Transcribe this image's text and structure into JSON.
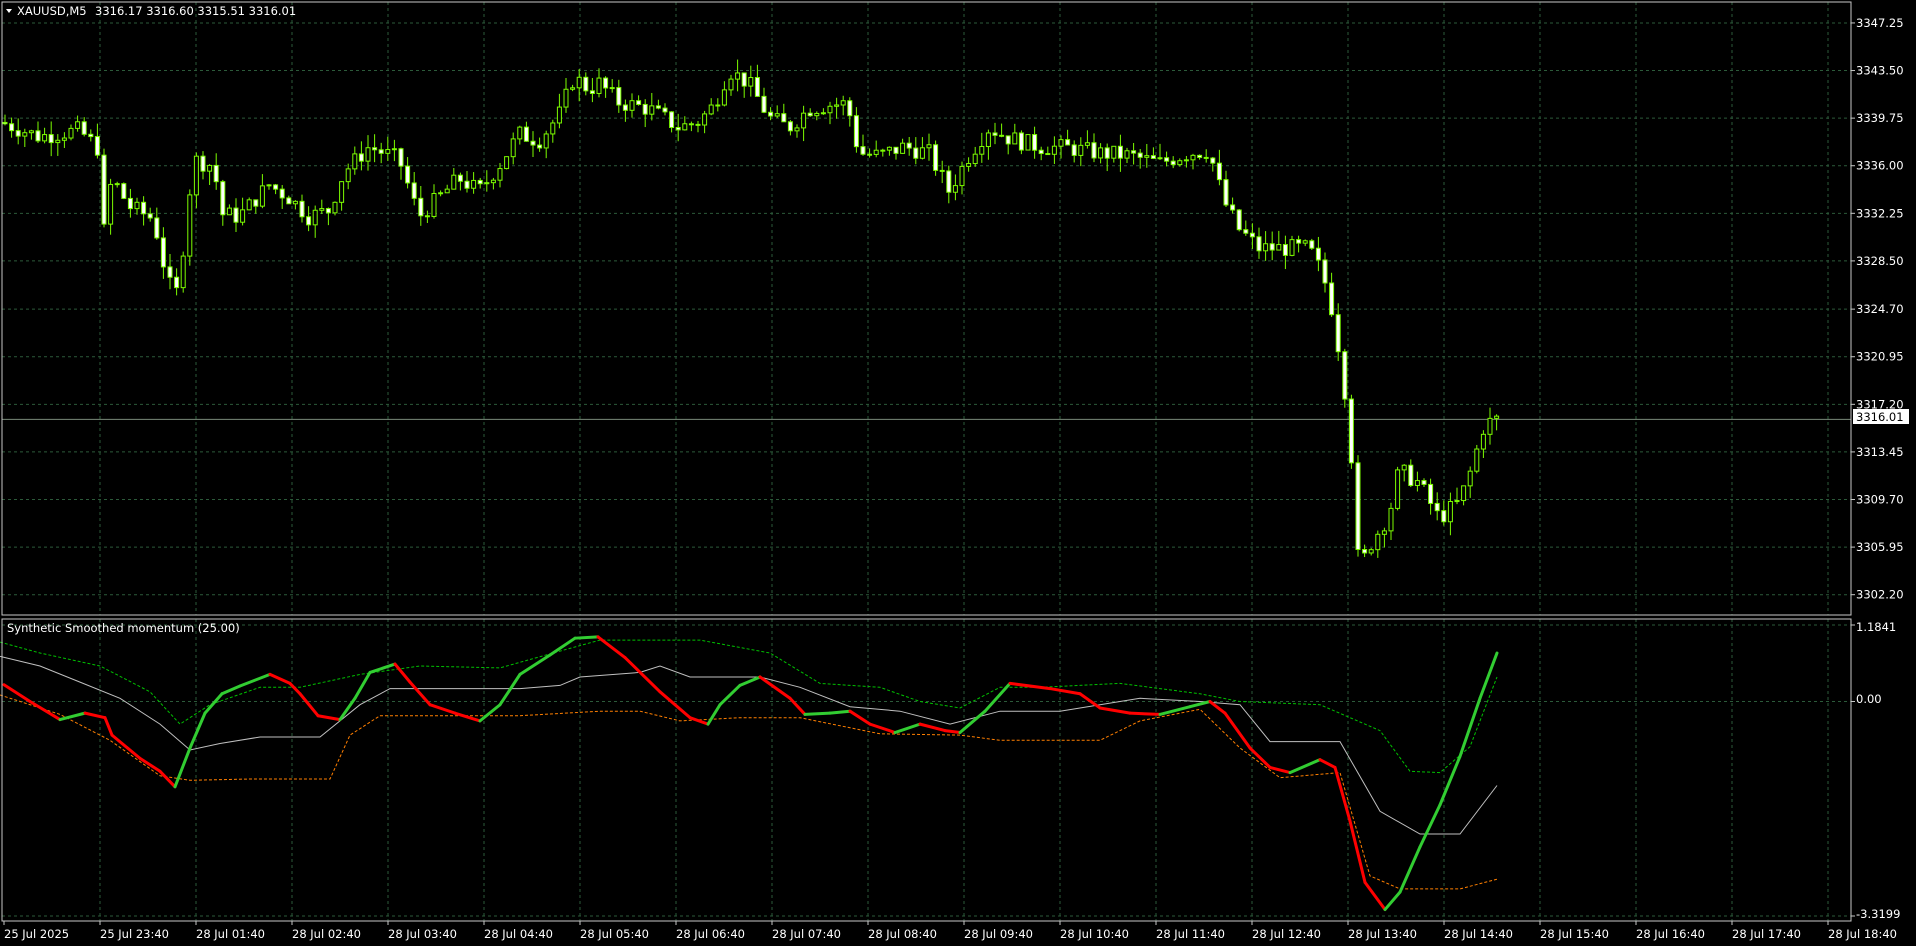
{
  "header": {
    "symbol_label": "XAUUSD,M5",
    "ohlc": "3316.17 3316.60 3315.51 3316.01",
    "arrow_icon": "triangle-down-icon"
  },
  "indicator": {
    "title": "Synthetic Smoothed momentum (25.00)",
    "y_top_label": "1.1841",
    "y_zero_label": "0.00",
    "y_bottom_label": "-3.3199"
  },
  "price_axis": {
    "labels": [
      "3347.25",
      "3343.50",
      "3339.75",
      "3336.00",
      "3332.25",
      "3328.50",
      "3324.70",
      "3320.95",
      "3317.20",
      "3313.45",
      "3309.70",
      "3305.95",
      "3302.20"
    ],
    "current_price": "3316.01"
  },
  "time_axis": {
    "labels": [
      "25 Jul 2025",
      "25 Jul 23:40",
      "28 Jul 01:40",
      "28 Jul 02:40",
      "28 Jul 03:40",
      "28 Jul 04:40",
      "28 Jul 05:40",
      "28 Jul 06:40",
      "28 Jul 07:40",
      "28 Jul 08:40",
      "28 Jul 09:40",
      "28 Jul 10:40",
      "28 Jul 11:40",
      "28 Jul 12:40",
      "28 Jul 13:40",
      "28 Jul 14:40",
      "28 Jul 15:40",
      "28 Jul 16:40",
      "28 Jul 17:40",
      "28 Jul 18:40"
    ]
  },
  "colors": {
    "background": "#000000",
    "grid": "#2c5a3a",
    "candle": "#7cfc00",
    "momentum_up": "#32cd32",
    "momentum_down": "#ff0000",
    "band_upper": "#00c000",
    "band_lower": "#ff7f00",
    "signal": "#c0c0c0"
  },
  "chart_data": [
    {
      "type": "candlestick",
      "title": "XAUUSD,M5",
      "ylim": [
        3300.6,
        3348.9
      ],
      "close_path": [
        [
          0,
          3339.5
        ],
        [
          40,
          3338.3
        ],
        [
          80,
          3338.8
        ],
        [
          100,
          3337.3
        ],
        [
          108,
          3327.0
        ],
        [
          112,
          3335.2
        ],
        [
          130,
          3332.8
        ],
        [
          155,
          3331.8
        ],
        [
          162,
          3329.0
        ],
        [
          176,
          3325.2
        ],
        [
          186,
          3330.5
        ],
        [
          194,
          3336.5
        ],
        [
          215,
          3336.0
        ],
        [
          222,
          3332.2
        ],
        [
          240,
          3332.0
        ],
        [
          270,
          3334.5
        ],
        [
          290,
          3333.5
        ],
        [
          310,
          3332.0
        ],
        [
          330,
          3332.5
        ],
        [
          345,
          3335.5
        ],
        [
          370,
          3337.5
        ],
        [
          400,
          3336.5
        ],
        [
          420,
          3332.0
        ],
        [
          440,
          3333.5
        ],
        [
          460,
          3335.0
        ],
        [
          480,
          3334.0
        ],
        [
          500,
          3336.0
        ],
        [
          520,
          3338.5
        ],
        [
          540,
          3338.0
        ],
        [
          560,
          3340.0
        ],
        [
          575,
          3343.0
        ],
        [
          590,
          3342.0
        ],
        [
          600,
          3342.5
        ],
        [
          620,
          3341.0
        ],
        [
          650,
          3340.5
        ],
        [
          680,
          3339.0
        ],
        [
          700,
          3339.5
        ],
        [
          715,
          3340.8
        ],
        [
          730,
          3343.5
        ],
        [
          750,
          3342.5
        ],
        [
          770,
          3339.8
        ],
        [
          790,
          3339.0
        ],
        [
          810,
          3340.5
        ],
        [
          830,
          3340.8
        ],
        [
          848,
          3340.9
        ],
        [
          860,
          3337.0
        ],
        [
          880,
          3336.8
        ],
        [
          905,
          3337.5
        ],
        [
          930,
          3337.0
        ],
        [
          950,
          3334.0
        ],
        [
          970,
          3336.8
        ],
        [
          990,
          3339.0
        ],
        [
          1010,
          3338.2
        ],
        [
          1040,
          3337.5
        ],
        [
          1070,
          3337.4
        ],
        [
          1100,
          3337.0
        ],
        [
          1130,
          3336.8
        ],
        [
          1160,
          3336.2
        ],
        [
          1190,
          3337.0
        ],
        [
          1210,
          3337.2
        ],
        [
          1225,
          3333.2
        ],
        [
          1240,
          3331.0
        ],
        [
          1260,
          3329.5
        ],
        [
          1280,
          3329.5
        ],
        [
          1310,
          3329.5
        ],
        [
          1320,
          3328.0
        ],
        [
          1330,
          3326.0
        ],
        [
          1340,
          3321.5
        ],
        [
          1350,
          3316.0
        ],
        [
          1360,
          3304.0
        ],
        [
          1370,
          3306.0
        ],
        [
          1390,
          3308.5
        ],
        [
          1400,
          3312.0
        ],
        [
          1420,
          3311.0
        ],
        [
          1440,
          3308.2
        ],
        [
          1460,
          3309.5
        ],
        [
          1470,
          3311.5
        ],
        [
          1485,
          3315.5
        ],
        [
          1495,
          3316.0
        ]
      ]
    },
    {
      "type": "line",
      "title": "Synthetic Smoothed momentum (25.00)",
      "ylim": [
        -3.3199,
        1.1841
      ],
      "momentum": [
        [
          4,
          0.26
        ],
        [
          30,
          0.0
        ],
        [
          60,
          -0.28
        ],
        [
          85,
          -0.18
        ],
        [
          105,
          -0.25
        ],
        [
          112,
          -0.52
        ],
        [
          140,
          -0.88
        ],
        [
          160,
          -1.08
        ],
        [
          175,
          -1.32
        ],
        [
          190,
          -0.72
        ],
        [
          205,
          -0.18
        ],
        [
          222,
          0.12
        ],
        [
          240,
          0.24
        ],
        [
          270,
          0.42
        ],
        [
          290,
          0.28
        ],
        [
          300,
          0.12
        ],
        [
          318,
          -0.22
        ],
        [
          340,
          -0.28
        ],
        [
          355,
          0.05
        ],
        [
          370,
          0.45
        ],
        [
          395,
          0.58
        ],
        [
          410,
          0.3
        ],
        [
          430,
          -0.05
        ],
        [
          455,
          -0.18
        ],
        [
          480,
          -0.3
        ],
        [
          500,
          -0.05
        ],
        [
          520,
          0.42
        ],
        [
          550,
          0.72
        ],
        [
          575,
          0.98
        ],
        [
          598,
          1.0
        ],
        [
          625,
          0.68
        ],
        [
          660,
          0.15
        ],
        [
          690,
          -0.25
        ],
        [
          708,
          -0.35
        ],
        [
          720,
          -0.05
        ],
        [
          740,
          0.25
        ],
        [
          760,
          0.38
        ],
        [
          790,
          0.05
        ],
        [
          805,
          -0.2
        ],
        [
          830,
          -0.18
        ],
        [
          850,
          -0.15
        ],
        [
          870,
          -0.35
        ],
        [
          895,
          -0.48
        ],
        [
          920,
          -0.35
        ],
        [
          945,
          -0.45
        ],
        [
          960,
          -0.48
        ],
        [
          985,
          -0.15
        ],
        [
          1010,
          0.28
        ],
        [
          1050,
          0.2
        ],
        [
          1080,
          0.12
        ],
        [
          1100,
          -0.1
        ],
        [
          1130,
          -0.18
        ],
        [
          1160,
          -0.2
        ],
        [
          1190,
          -0.08
        ],
        [
          1210,
          0.0
        ],
        [
          1225,
          -0.18
        ],
        [
          1250,
          -0.72
        ],
        [
          1270,
          -1.02
        ],
        [
          1290,
          -1.1
        ],
        [
          1320,
          -0.9
        ],
        [
          1335,
          -1.02
        ],
        [
          1350,
          -1.85
        ],
        [
          1365,
          -2.8
        ],
        [
          1385,
          -3.22
        ],
        [
          1400,
          -2.95
        ],
        [
          1420,
          -2.25
        ],
        [
          1440,
          -1.6
        ],
        [
          1460,
          -0.85
        ],
        [
          1480,
          0.05
        ],
        [
          1497,
          0.75
        ]
      ],
      "band_upper": [
        [
          0,
          0.92
        ],
        [
          40,
          0.75
        ],
        [
          100,
          0.55
        ],
        [
          150,
          0.15
        ],
        [
          180,
          -0.35
        ],
        [
          210,
          -0.05
        ],
        [
          260,
          0.22
        ],
        [
          300,
          0.22
        ],
        [
          360,
          0.42
        ],
        [
          420,
          0.55
        ],
        [
          500,
          0.52
        ],
        [
          560,
          0.78
        ],
        [
          600,
          0.95
        ],
        [
          700,
          0.95
        ],
        [
          770,
          0.75
        ],
        [
          820,
          0.28
        ],
        [
          880,
          0.22
        ],
        [
          920,
          0.0
        ],
        [
          960,
          -0.1
        ],
        [
          1000,
          0.22
        ],
        [
          1040,
          0.22
        ],
        [
          1120,
          0.28
        ],
        [
          1200,
          0.12
        ],
        [
          1240,
          0.0
        ],
        [
          1320,
          -0.05
        ],
        [
          1380,
          -0.45
        ],
        [
          1410,
          -1.08
        ],
        [
          1440,
          -1.1
        ],
        [
          1470,
          -0.7
        ],
        [
          1497,
          0.38
        ]
      ],
      "band_lower": [
        [
          0,
          0.1
        ],
        [
          60,
          -0.2
        ],
        [
          110,
          -0.6
        ],
        [
          160,
          -1.15
        ],
        [
          190,
          -1.22
        ],
        [
          250,
          -1.2
        ],
        [
          330,
          -1.2
        ],
        [
          350,
          -0.52
        ],
        [
          380,
          -0.22
        ],
        [
          460,
          -0.22
        ],
        [
          520,
          -0.22
        ],
        [
          600,
          -0.15
        ],
        [
          640,
          -0.15
        ],
        [
          680,
          -0.3
        ],
        [
          740,
          -0.25
        ],
        [
          800,
          -0.25
        ],
        [
          880,
          -0.5
        ],
        [
          960,
          -0.52
        ],
        [
          1000,
          -0.6
        ],
        [
          1100,
          -0.6
        ],
        [
          1140,
          -0.3
        ],
        [
          1200,
          -0.12
        ],
        [
          1240,
          -0.72
        ],
        [
          1280,
          -1.18
        ],
        [
          1340,
          -1.1
        ],
        [
          1370,
          -2.7
        ],
        [
          1400,
          -2.9
        ],
        [
          1460,
          -2.9
        ],
        [
          1497,
          -2.75
        ]
      ],
      "signal": [
        [
          0,
          0.7
        ],
        [
          40,
          0.55
        ],
        [
          80,
          0.3
        ],
        [
          120,
          0.05
        ],
        [
          160,
          -0.35
        ],
        [
          190,
          -0.75
        ],
        [
          220,
          -0.65
        ],
        [
          260,
          -0.55
        ],
        [
          320,
          -0.55
        ],
        [
          360,
          -0.05
        ],
        [
          390,
          0.2
        ],
        [
          440,
          0.2
        ],
        [
          520,
          0.2
        ],
        [
          560,
          0.25
        ],
        [
          580,
          0.38
        ],
        [
          640,
          0.45
        ],
        [
          660,
          0.55
        ],
        [
          690,
          0.38
        ],
        [
          760,
          0.38
        ],
        [
          800,
          0.22
        ],
        [
          850,
          -0.08
        ],
        [
          900,
          -0.15
        ],
        [
          950,
          -0.35
        ],
        [
          1000,
          -0.15
        ],
        [
          1060,
          -0.15
        ],
        [
          1140,
          0.05
        ],
        [
          1200,
          0.0
        ],
        [
          1240,
          -0.05
        ],
        [
          1270,
          -0.62
        ],
        [
          1340,
          -0.62
        ],
        [
          1380,
          -1.7
        ],
        [
          1420,
          -2.05
        ],
        [
          1460,
          -2.05
        ],
        [
          1497,
          -1.3
        ]
      ]
    }
  ]
}
